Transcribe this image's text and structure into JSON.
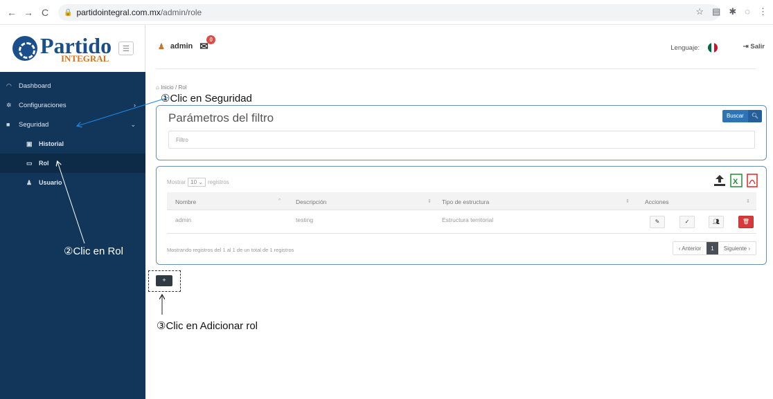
{
  "browser": {
    "back": "←",
    "forward": "→",
    "reload": "C",
    "url_host": "partidointegral.com.mx",
    "url_path": "/admin/role",
    "lock_icon": "lock-icon",
    "icons": [
      "star-icon",
      "reader-icon",
      "extensions-icon",
      "profile-icon",
      "kebab-menu-icon"
    ]
  },
  "logo": {
    "main": "Partido",
    "sub": "INTEGRAL"
  },
  "sidebar": {
    "items": [
      {
        "label": "Dashboard",
        "icon": "dashboard-icon"
      },
      {
        "label": "Configuraciones",
        "icon": "gear-icon",
        "chevron": "›"
      },
      {
        "label": "Seguridad",
        "icon": "lock-icon",
        "chevron": "⌄"
      },
      {
        "label": "Historial",
        "icon": "history-icon"
      },
      {
        "label": "Rol",
        "icon": "card-icon"
      },
      {
        "label": "Usuario",
        "icon": "user-icon"
      }
    ]
  },
  "header": {
    "user": "admin",
    "mail_badge": "0",
    "language_label": "Lenguaje:",
    "logout": "Salir"
  },
  "breadcrumb": {
    "home": "Inicio",
    "separator": "/",
    "current": "Rol"
  },
  "filter": {
    "title": "Parámetros del filtro",
    "search_button": "Buscar",
    "placeholder": "Filtro"
  },
  "table": {
    "show_prefix": "Mostrar",
    "page_length": "10",
    "show_suffix": "registros",
    "columns": [
      "Nombre",
      "Descripción",
      "Tipo de estructura",
      "Acciones"
    ],
    "rows": [
      {
        "nombre": "admin",
        "descripcion": "testing",
        "tipo": "Estructura territorial"
      }
    ],
    "actions": [
      "edit-icon",
      "check-icon",
      "users-icon",
      "trash-icon"
    ],
    "info": "Mostrando registros del 1 al 1 de un total de 1 registros",
    "pager": {
      "prev": "‹ Anterior",
      "current": "1",
      "next": "Siguiente ›"
    }
  },
  "add_button": "+",
  "annotations": {
    "step1": "①Clic en Seguridad",
    "step2": "②Clic en Rol",
    "step3": "③Clic en Adicionar rol"
  },
  "colors": {
    "sidebar": "#12365a",
    "accent": "#2c73b8",
    "delete": "#d63a3a",
    "annotation_arrow": "#1e88e5"
  }
}
